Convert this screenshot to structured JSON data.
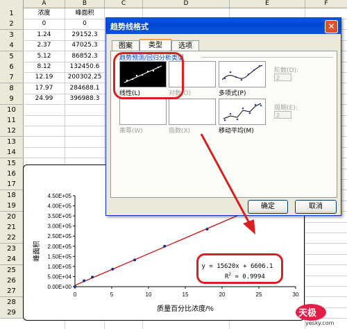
{
  "spreadsheet": {
    "columns": [
      "A",
      "B",
      "C",
      "D",
      "E",
      "F"
    ],
    "rows": [
      "1",
      "2",
      "3",
      "4",
      "5",
      "6",
      "7",
      "8",
      "9",
      "10",
      "11",
      "12",
      "13",
      "14",
      "15",
      "16",
      "17",
      "18",
      "19",
      "20",
      "21",
      "22",
      "23",
      "24",
      "25",
      "26",
      "27",
      "28",
      "29"
    ],
    "header_row": {
      "a": "浓度",
      "b": "峰面积"
    },
    "data": [
      {
        "a": "0",
        "b": "0"
      },
      {
        "a": "1.24",
        "b": "29152.3"
      },
      {
        "a": "2.37",
        "b": "47025.3"
      },
      {
        "a": "5.12",
        "b": "86852.3"
      },
      {
        "a": "8.12",
        "b": "132450.6"
      },
      {
        "a": "12.19",
        "b": "200302.25"
      },
      {
        "a": "17.97",
        "b": "284688.1"
      },
      {
        "a": "24.99",
        "b": "396988.3"
      }
    ]
  },
  "dialog": {
    "title": "趋势线格式",
    "close_glyph": "✕",
    "tabs": [
      {
        "label": "图案",
        "active": false
      },
      {
        "label": "类型",
        "active": true
      },
      {
        "label": "选项",
        "active": false
      }
    ],
    "section_label": "趋势预测/回归分析类型",
    "types": [
      {
        "label": "线性(L)",
        "enabled": true,
        "selected": true
      },
      {
        "label": "对数(O)",
        "enabled": false
      },
      {
        "label": "多项式(P)",
        "enabled": true
      },
      {
        "label": "乘幂(W)",
        "enabled": false
      },
      {
        "label": "指数(X)",
        "enabled": false
      },
      {
        "label": "移动平均(M)",
        "enabled": true
      }
    ],
    "order_label": "阶数(D):",
    "order_value": "2",
    "period_label": "周期(E):",
    "period_value": "2",
    "ok_label": "确定",
    "cancel_label": "取消"
  },
  "chart_data": {
    "type": "scatter",
    "series": [
      {
        "x": [
          0,
          1.24,
          2.37,
          5.12,
          8.12,
          12.19,
          17.97,
          24.99
        ],
        "y": [
          0,
          29152.3,
          47025.3,
          86852.3,
          132450.6,
          200302.25,
          284688.1,
          396988.3
        ]
      }
    ],
    "trendline": {
      "slope": 15620,
      "intercept": 6606.1,
      "color": "#cc0000"
    },
    "ylabel": "峰面积",
    "xlabel": "质量百分比浓度/%",
    "xlim": [
      0,
      30
    ],
    "ylim": [
      0,
      450000
    ],
    "xticks": [
      "0",
      "5",
      "10",
      "15",
      "20",
      "25",
      "30"
    ],
    "yticks": [
      "0.00E+00",
      "5.00E+04",
      "1.00E+05",
      "1.50E+05",
      "2.00E+05",
      "2.50E+05",
      "3.00E+05",
      "3.50E+05",
      "4.00E+05",
      "4.50E+05"
    ],
    "equation": "y = 15620x + 6606.1",
    "r_squared_prefix": "R",
    "r_squared_sup": "2",
    "r_squared_value": " = 0.9994"
  },
  "watermark": {
    "logo_text": "天极",
    "url": "yesky.com"
  },
  "colors": {
    "annotation": "#d92020",
    "titlebar": "#0347d2",
    "trendline": "#cc0000"
  }
}
